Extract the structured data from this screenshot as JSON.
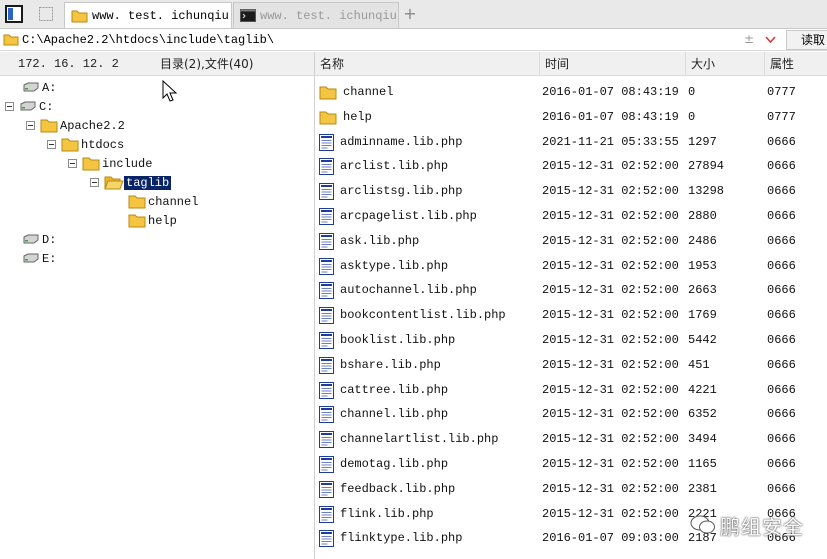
{
  "tabs": [
    {
      "label": "www. test. ichunqiu",
      "icon": "folder-icon"
    },
    {
      "label": "www. test. ichunqiu",
      "icon": "terminal-icon"
    }
  ],
  "address": {
    "path": "C:\\Apache2.2\\htdocs\\include\\taglib\\",
    "read_label": "读取"
  },
  "left_header": {
    "ip": "172. 16. 12. 2",
    "summary": "目录(2),文件(40)"
  },
  "columns": {
    "name": "名称",
    "time": "时间",
    "size": "大小",
    "attr": "属性"
  },
  "tree": {
    "drive_a": "A:",
    "drive_c": "C:",
    "apache": "Apache2.2",
    "htdocs": "htdocs",
    "include": "include",
    "taglib": "taglib",
    "channel": "channel",
    "help": "help",
    "drive_d": "D:",
    "drive_e": "E:"
  },
  "files": [
    {
      "name": "channel",
      "time": "2016-01-07 08:43:19",
      "size": "0",
      "attr": "0777",
      "type": "folder"
    },
    {
      "name": "help",
      "time": "2016-01-07 08:43:19",
      "size": "0",
      "attr": "0777",
      "type": "folder"
    },
    {
      "name": "adminname.lib.php",
      "time": "2021-11-21 05:33:55",
      "size": "1297",
      "attr": "0666",
      "type": "file"
    },
    {
      "name": "arclist.lib.php",
      "time": "2015-12-31 02:52:00",
      "size": "27894",
      "attr": "0666",
      "type": "file"
    },
    {
      "name": "arclistsg.lib.php",
      "time": "2015-12-31 02:52:00",
      "size": "13298",
      "attr": "0666",
      "type": "file"
    },
    {
      "name": "arcpagelist.lib.php",
      "time": "2015-12-31 02:52:00",
      "size": "2880",
      "attr": "0666",
      "type": "file"
    },
    {
      "name": "ask.lib.php",
      "time": "2015-12-31 02:52:00",
      "size": "2486",
      "attr": "0666",
      "type": "file"
    },
    {
      "name": "asktype.lib.php",
      "time": "2015-12-31 02:52:00",
      "size": "1953",
      "attr": "0666",
      "type": "file"
    },
    {
      "name": "autochannel.lib.php",
      "time": "2015-12-31 02:52:00",
      "size": "2663",
      "attr": "0666",
      "type": "file"
    },
    {
      "name": "bookcontentlist.lib.php",
      "time": "2015-12-31 02:52:00",
      "size": "1769",
      "attr": "0666",
      "type": "file"
    },
    {
      "name": "booklist.lib.php",
      "time": "2015-12-31 02:52:00",
      "size": "5442",
      "attr": "0666",
      "type": "file"
    },
    {
      "name": "bshare.lib.php",
      "time": "2015-12-31 02:52:00",
      "size": "451",
      "attr": "0666",
      "type": "file"
    },
    {
      "name": "cattree.lib.php",
      "time": "2015-12-31 02:52:00",
      "size": "4221",
      "attr": "0666",
      "type": "file"
    },
    {
      "name": "channel.lib.php",
      "time": "2015-12-31 02:52:00",
      "size": "6352",
      "attr": "0666",
      "type": "file"
    },
    {
      "name": "channelartlist.lib.php",
      "time": "2015-12-31 02:52:00",
      "size": "3494",
      "attr": "0666",
      "type": "file"
    },
    {
      "name": "demotag.lib.php",
      "time": "2015-12-31 02:52:00",
      "size": "1165",
      "attr": "0666",
      "type": "file"
    },
    {
      "name": "feedback.lib.php",
      "time": "2015-12-31 02:52:00",
      "size": "2381",
      "attr": "0666",
      "type": "file"
    },
    {
      "name": "flink.lib.php",
      "time": "2015-12-31 02:52:00",
      "size": "2221",
      "attr": "0666",
      "type": "file"
    },
    {
      "name": "flinktype.lib.php",
      "time": "2016-01-07 09:03:00",
      "size": "2187",
      "attr": "0666",
      "type": "file"
    }
  ],
  "watermark": {
    "text": "鹏组安全"
  },
  "colors": {
    "selection": "#0a246a",
    "folder": "#f5c542",
    "file_icon": "#1f3c9c"
  }
}
